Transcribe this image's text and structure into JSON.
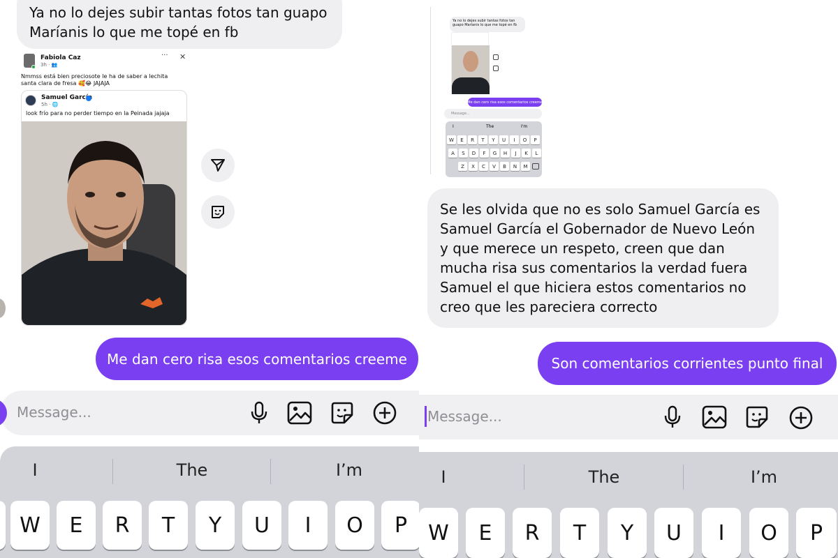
{
  "left": {
    "incoming_message": "Ya no lo dejes subir tantas fotos tan guapo Maríanis lo que me topé en fb",
    "fb_post": {
      "author": "Fabiola Caz",
      "meta": "3h · 👥",
      "more": "···",
      "close": "✕",
      "text": "Nmmss está bien preciosote  le ha de saber a lechita santa clara de fresa 🥰😂 JAJAJA",
      "shared": {
        "author": "Samuel García",
        "meta": "5h · 🌐",
        "text": "look frío para no perder tiempo en la Peinada jajaja"
      }
    },
    "outgoing_message": "Me dan cero risa esos comentarios creeme",
    "composer_placeholder": "Message...",
    "suggestions": [
      "I",
      "The",
      "I’m"
    ],
    "keys": [
      "W",
      "E",
      "R",
      "T",
      "Y",
      "U",
      "I",
      "O",
      "P"
    ]
  },
  "right": {
    "mini": {
      "incoming": "Ya no lo dejes subir tantas fotos tan guapo Maríanis lo que me topé en fb",
      "outgoing": "Me dan cero risa esos comentarios creeme",
      "placeholder": "Message...",
      "suggestions": [
        "I",
        "The",
        "I'm"
      ],
      "row1": [
        "W",
        "E",
        "R",
        "T",
        "Y",
        "U",
        "I",
        "O",
        "P"
      ],
      "row2": [
        "A",
        "S",
        "D",
        "F",
        "G",
        "H",
        "J",
        "K",
        "L"
      ],
      "row3": [
        "Z",
        "X",
        "C",
        "V",
        "B",
        "N",
        "M"
      ]
    },
    "incoming_message": "Se les olvida que no es solo Samuel García es Samuel García el Gobernador de Nuevo León y que merece un respeto, creen que dan mucha risa sus comentarios la verdad fuera Samuel el que hiciera estos comentarios no creo que les pareciera correcto",
    "outgoing_message": "Son comentarios corrientes punto final",
    "composer_placeholder": "Message...",
    "suggestions": [
      "I",
      "The",
      "I’m"
    ],
    "keys": [
      "W",
      "E",
      "R",
      "T",
      "Y",
      "U",
      "I",
      "O",
      "P"
    ]
  },
  "colors": {
    "accent": "#7b3ff2",
    "incoming_bubble": "#efeff1",
    "keyboard": "#d2d4da"
  }
}
